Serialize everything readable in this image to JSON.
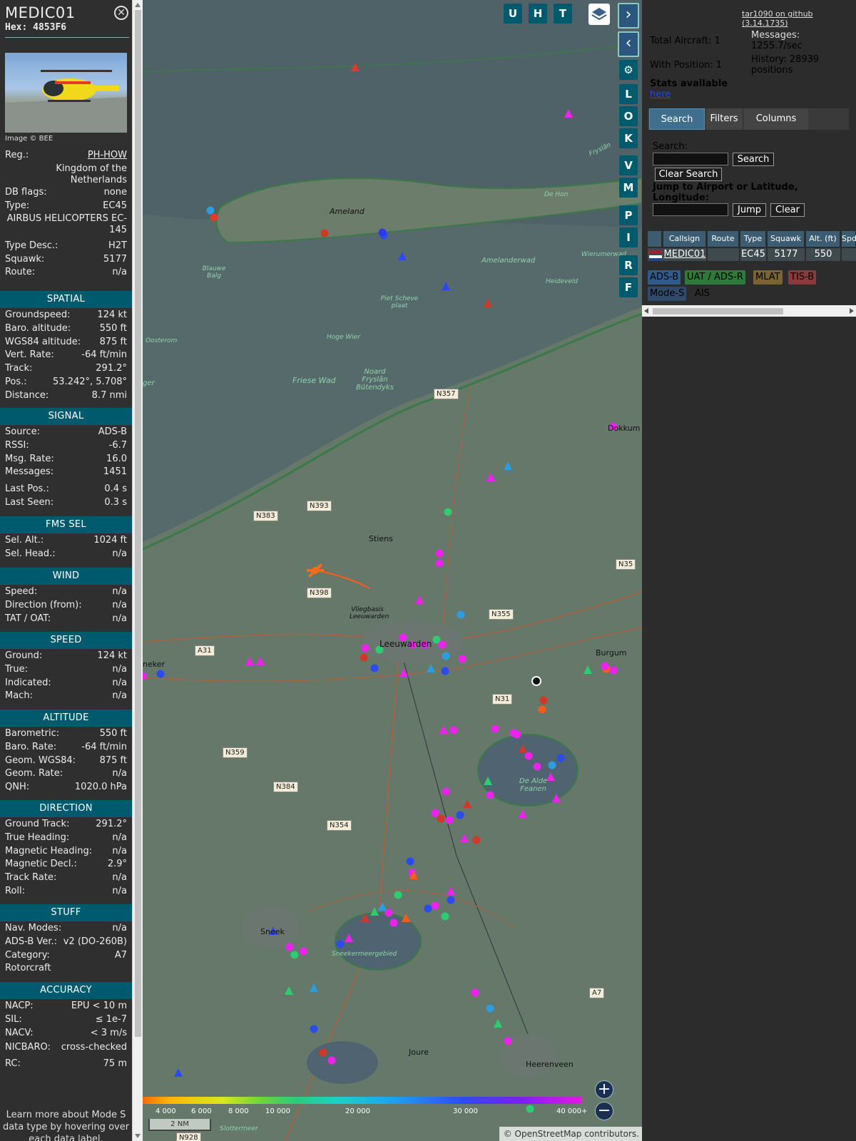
{
  "info": {
    "callsign": "MEDIC01",
    "hex_line": "Hex: 4853F6",
    "photo_credit": "Image © BEE",
    "general": [
      {
        "k": "Reg.:",
        "v": "PH-HOW"
      },
      {
        "k": "DB flags:",
        "v": "none"
      },
      {
        "k": "Type:",
        "v": "EC45"
      },
      {
        "k": "Type Desc.:",
        "v": "H2T"
      },
      {
        "k": "Squawk:",
        "v": "5177"
      },
      {
        "k": "Route:",
        "v": "n/a"
      }
    ],
    "country": "Kingdom of the Netherlands",
    "type_full": "AIRBUS HELICOPTERS EC-145",
    "sections": {
      "spatial": "SPATIAL",
      "signal": "SIGNAL",
      "fms": "FMS SEL",
      "wind": "WIND",
      "speed": "SPEED",
      "altitude": "ALTITUDE",
      "direction": "DIRECTION",
      "stuff": "STUFF",
      "accuracy": "ACCURACY"
    },
    "spatial": [
      {
        "k": "Groundspeed:",
        "v": "124 kt"
      },
      {
        "k": "Baro. altitude:",
        "v": "550 ft"
      },
      {
        "k": "WGS84 altitude:",
        "v": "875 ft"
      },
      {
        "k": "Vert. Rate:",
        "v": "-64 ft/min"
      },
      {
        "k": "Track:",
        "v": "291.2°"
      },
      {
        "k": "Pos.:",
        "v": "53.242°, 5.708°"
      },
      {
        "k": "Distance:",
        "v": "8.7 nmi"
      }
    ],
    "signal": [
      {
        "k": "Source:",
        "v": "ADS-B"
      },
      {
        "k": "RSSI:",
        "v": "-6.7"
      },
      {
        "k": "Msg. Rate:",
        "v": "16.0"
      },
      {
        "k": "Messages:",
        "v": "1451"
      },
      {
        "k": "Last Pos.:",
        "v": "0.4 s"
      },
      {
        "k": "Last Seen:",
        "v": "0.3 s"
      }
    ],
    "fms": [
      {
        "k": "Sel. Alt.:",
        "v": "1024 ft"
      },
      {
        "k": "Sel. Head.:",
        "v": "n/a"
      }
    ],
    "wind": [
      {
        "k": "Speed:",
        "v": "n/a"
      },
      {
        "k": "Direction (from):",
        "v": "n/a"
      },
      {
        "k": "TAT / OAT:",
        "v": "n/a"
      }
    ],
    "speed": [
      {
        "k": "Ground:",
        "v": "124 kt"
      },
      {
        "k": "True:",
        "v": "n/a"
      },
      {
        "k": "Indicated:",
        "v": "n/a"
      },
      {
        "k": "Mach:",
        "v": "n/a"
      }
    ],
    "altitude": [
      {
        "k": "Barometric:",
        "v": "550 ft"
      },
      {
        "k": "Baro. Rate:",
        "v": "-64 ft/min"
      },
      {
        "k": "Geom. WGS84:",
        "v": "875 ft"
      },
      {
        "k": "Geom. Rate:",
        "v": "n/a"
      },
      {
        "k": "QNH:",
        "v": "1020.0 hPa"
      }
    ],
    "direction": [
      {
        "k": "Ground Track:",
        "v": "291.2°"
      },
      {
        "k": "True Heading:",
        "v": "n/a"
      },
      {
        "k": "Magnetic Heading:",
        "v": "n/a"
      },
      {
        "k": "Magnetic Decl.:",
        "v": "2.9°"
      },
      {
        "k": "Track Rate:",
        "v": "n/a"
      },
      {
        "k": "Roll:",
        "v": "n/a"
      }
    ],
    "stuff": [
      {
        "k": "Nav. Modes:",
        "v": "n/a"
      },
      {
        "k": "ADS-B Ver.:",
        "v": "v2 (DO-260B)"
      },
      {
        "k": "Category:",
        "v": "A7"
      },
      {
        "k": "Rotorcraft",
        "v": ""
      }
    ],
    "accuracy": [
      {
        "k": "NACP:",
        "v": "EPU < 10 m"
      },
      {
        "k": "SIL:",
        "v": "≤ 1e-7"
      },
      {
        "k": "NACV:",
        "v": "< 3 m/s"
      },
      {
        "k": "NICBARO:",
        "v": "cross-checked"
      },
      {
        "k": "RC:",
        "v": "75 m"
      }
    ],
    "footer": "Learn more about Mode S data type by hovering over each data label."
  },
  "map": {
    "top_buttons": [
      "U",
      "H",
      "T"
    ],
    "side_buttons": [
      "L",
      "O",
      "K",
      "V",
      "M",
      "P",
      "I",
      "R",
      "F"
    ],
    "labels": {
      "ameland": "Ameland",
      "amelanderwad": "Amelanderwad",
      "heideveld": "Heideveld",
      "wierumerwad": "Wierumerwad",
      "dehon": "De Hon",
      "blauwe_balg": "Blauwe Balg",
      "piet_scheve": "Piet Scheve plaat",
      "oosterom": "Oosterom",
      "hoge_wier": "Hoge Wier",
      "friese_wad": "Friese Wad",
      "noard": "Noard Fryslân Bûtendyks",
      "stiens": "Stiens",
      "vliegbasis": "Vliegbasis Leeuwarden",
      "leeuwarden": "Leeuwarden",
      "dokkum": "Dokkum",
      "burgum": "Burgum",
      "de_alde_feanen": "De Alde Feanen",
      "sneek": "Sneek",
      "sneekermeer": "Sneekermeergebied",
      "joure": "Joure",
      "heerenveen": "Heerenveen",
      "neker": "neker",
      "ger": "ger",
      "fryslan": "Fryslân",
      "slotermeer": "Slottermeer"
    },
    "roads": [
      "N357",
      "N393",
      "N383",
      "N398",
      "N355",
      "N31",
      "A31",
      "N359",
      "N384",
      "N354",
      "A7",
      "N928",
      "N35"
    ],
    "color_scale": [
      "4 000",
      "6 000",
      "8 000",
      "10 000",
      "20 000",
      "30 000",
      "40 000+"
    ],
    "scale_label": "2 NM",
    "attribution": "© OpenStreetMap contributors."
  },
  "side": {
    "version_link": "tar1090 on github (3.14.1735)",
    "total_aircraft": "Total Aircraft: 1",
    "with_position": "With Position: 1",
    "messages_label": "Messages:",
    "messages_value": "1255.7/sec",
    "history_label": "History: 28939",
    "history_unit": "positions",
    "stats_label": "Stats available",
    "stats_link": "here",
    "tabs": [
      "Search",
      "Filters",
      "Columns"
    ],
    "search_label": "Search:",
    "search_button": "Search",
    "clear_search_button": "Clear Search",
    "jump_label": "Jump to Airport or Latitude, Longitude:",
    "jump_button": "Jump",
    "clear_button": "Clear",
    "table_headers": [
      "Callsign",
      "Route",
      "Type",
      "Squawk",
      "Alt. (ft)",
      "Spd"
    ],
    "table_row": {
      "callsign": "MEDIC01",
      "route": "",
      "type": "EC45",
      "squawk": "5177",
      "alt": "550"
    },
    "badges": [
      "ADS-B",
      "UAT / ADS-R",
      "MLAT",
      "TIS-B",
      "Mode-S",
      "AIS"
    ],
    "colors": {
      "adsb": "#2f5b8a",
      "uat": "#2f7a3a",
      "mlat": "#7a6532",
      "tisb": "#8a3a3a",
      "modes": "#2f4a6a"
    }
  }
}
